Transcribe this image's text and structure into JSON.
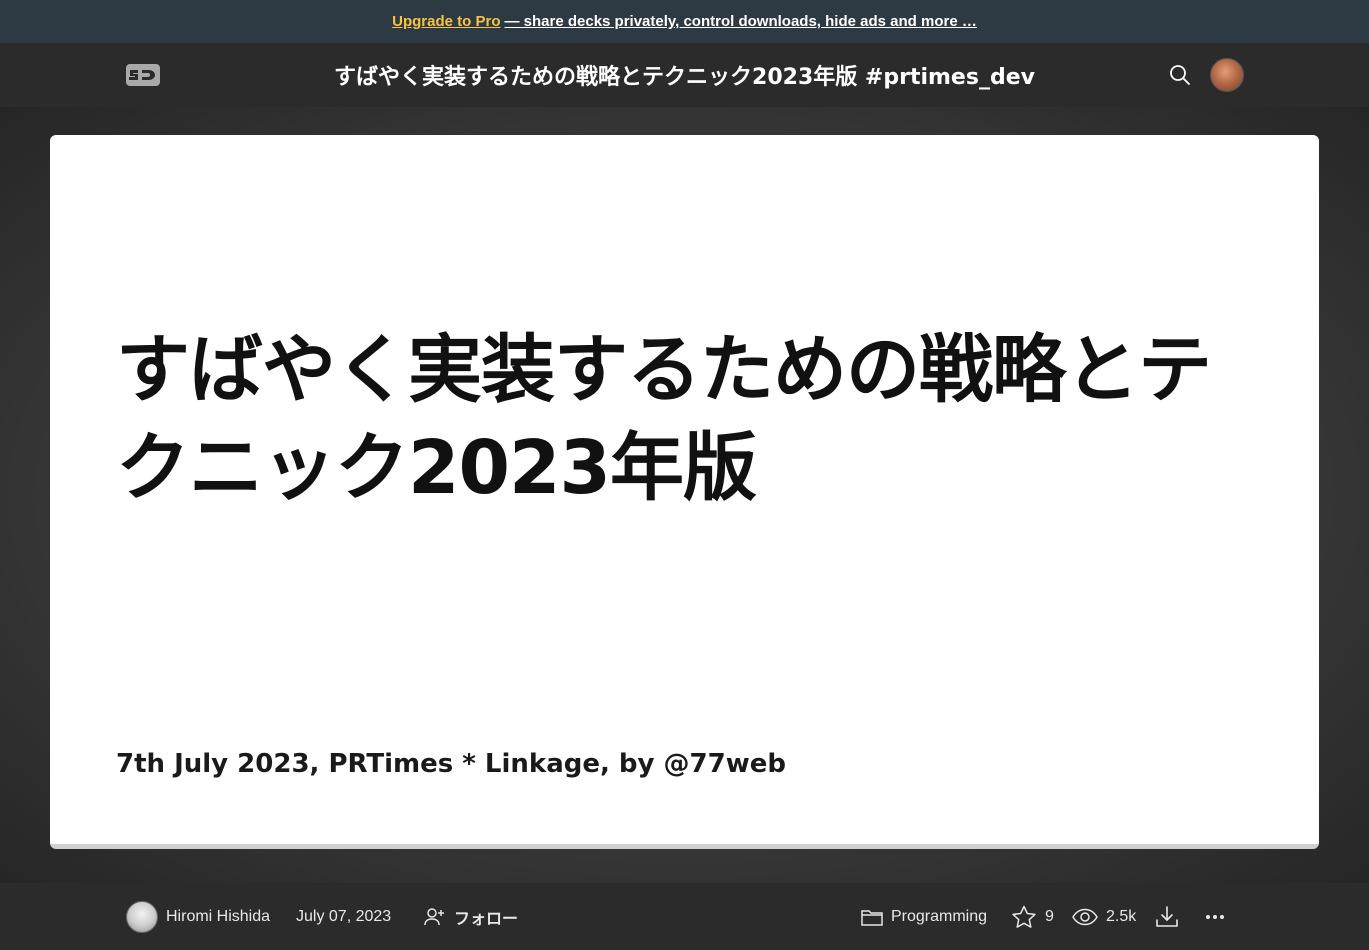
{
  "promo": {
    "link_text": "Upgrade to Pro",
    "rest_text": "— share decks privately, control downloads, hide ads and more …"
  },
  "header": {
    "logo_text": "SD",
    "deck_title": "すばやく実装するための戦略とテクニック2023年版 #prtimes_dev"
  },
  "slide": {
    "title": "すばやく実装するための戦略とテクニック2023年版",
    "subtitle": "7th July 2023, PRTimes * Linkage, by @77web"
  },
  "footer": {
    "author_name": "Hiromi Hishida",
    "date": "July 07, 2023",
    "follow_label": "フォロー",
    "category": "Programming",
    "stars": "9",
    "views": "2.5k"
  },
  "colors": {
    "promo_bg": "#2d3a43",
    "pro_accent": "#f6c343",
    "header_bg": "#2b2b2b",
    "slide_bg": "#ffffff"
  },
  "icons": [
    "speakerdeck-logo",
    "search-icon",
    "user-avatar",
    "person-add-icon",
    "folder-icon",
    "star-icon",
    "eye-icon",
    "download-icon",
    "more-icon"
  ]
}
